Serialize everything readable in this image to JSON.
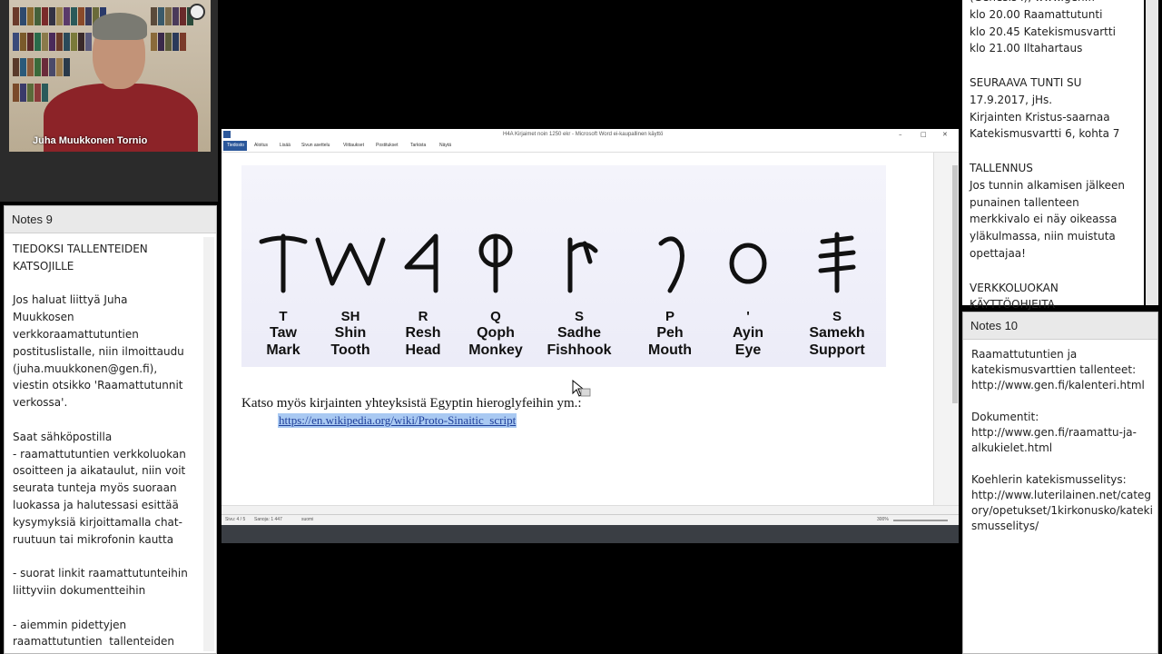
{
  "webcam": {
    "presenter_name": "Juha Muukkonen Tornio"
  },
  "notes9": {
    "title": "Notes 9",
    "text": "TIEDOKSI TALLENTEIDEN\nKATSOJILLE\n\nJos haluat liittyä Juha\nMuukkosen\nverkkoraamattutuntien\npostituslistalle, niin ilmoittaudu\n(juha.muukkonen@gen.fi),\nviestin otsikko 'Raamattutunnit\nverkossa'.\n\nSaat sähköpostilla\n- raamattutuntien verkkoluokan\nosoitteen ja aikataulut, niin voit\nseurata tunteja myös suoraan\nluokassa ja halutessasi esittää\nkysymyksiä kirjoittamalla chat-\nruutuun tai mikrofonin kautta\n\n- suorat linkit raamattutunteihin\nliittyviin dokumentteihin\n\n- aiemmin pidettyjen\nraamattutuntien  tallenteiden"
  },
  "notes_top": {
    "text": "(Genesis I), www.gen.fi\nklo 20.00 Raamattutunti\nklo 20.45 Katekismusvartti\nklo 21.00 Iltahartaus\n\nSEURAAVA TUNTI SU\n17.9.2017, jHs.\nKirjainten Kristus-saarnaa\nKatekismusvartti 6, kohta 7\n\nTALLENNUS\nJos tunnin alkamisen jälkeen\npunainen tallenteen\nmerkkivalo ei näy oikeassa\nyläkulmassa, niin muistuta\nopettajaa!\n\nVERKKOLUOKAN\nKÄYTTÖOHJEITA"
  },
  "notes10": {
    "title": "Notes 10",
    "text": "Raamattutuntien ja\nkatekismusvarttien tallenteet:\nhttp://www.gen.fi/kalenteri.html\n\nDokumentit:\nhttp://www.gen.fi/raamattu-ja-\nalkukielet.html\n\nKoehlerin katekismusselitys:\nhttp://www.luterilainen.net/categ\nory/opetukset/1kirkonusko/kateki\nsmusselitys/"
  },
  "word": {
    "title": "H4A Kirjaimet noin 1250 ekr - Microsoft Word ei-kaupallinen käyttö",
    "tabs": [
      "Tiedosto",
      "Aloitus",
      "Lisää",
      "Sivun asettelu",
      "Viittaukset",
      "Postitukset",
      "Tarkista",
      "Näytä"
    ],
    "status_page": "Sivu: 4 / 5",
    "status_words": "Sanoja: 1 447",
    "status_lang": "suomi",
    "status_zoom": "300%",
    "doc_text": "Katso myös kirjainten yhteyksistä Egyptin hieroglyfeihin ym.:",
    "doc_link": "https://en.wikipedia.org/wiki/Proto-Sinaitic_script"
  },
  "letters": [
    {
      "letter": "T",
      "name": "Taw",
      "meaning": "Mark"
    },
    {
      "letter": "SH",
      "name": "Shin",
      "meaning": "Tooth"
    },
    {
      "letter": "R",
      "name": "Resh",
      "meaning": "Head"
    },
    {
      "letter": "Q",
      "name": "Qoph",
      "meaning": "Monkey"
    },
    {
      "letter": "S",
      "name": "Sadhe",
      "meaning": "Fishhook"
    },
    {
      "letter": "P",
      "name": "Peh",
      "meaning": "Mouth"
    },
    {
      "letter": "'",
      "name": "Ayin",
      "meaning": "Eye"
    },
    {
      "letter": "S",
      "name": "Samekh",
      "meaning": "Support"
    }
  ]
}
